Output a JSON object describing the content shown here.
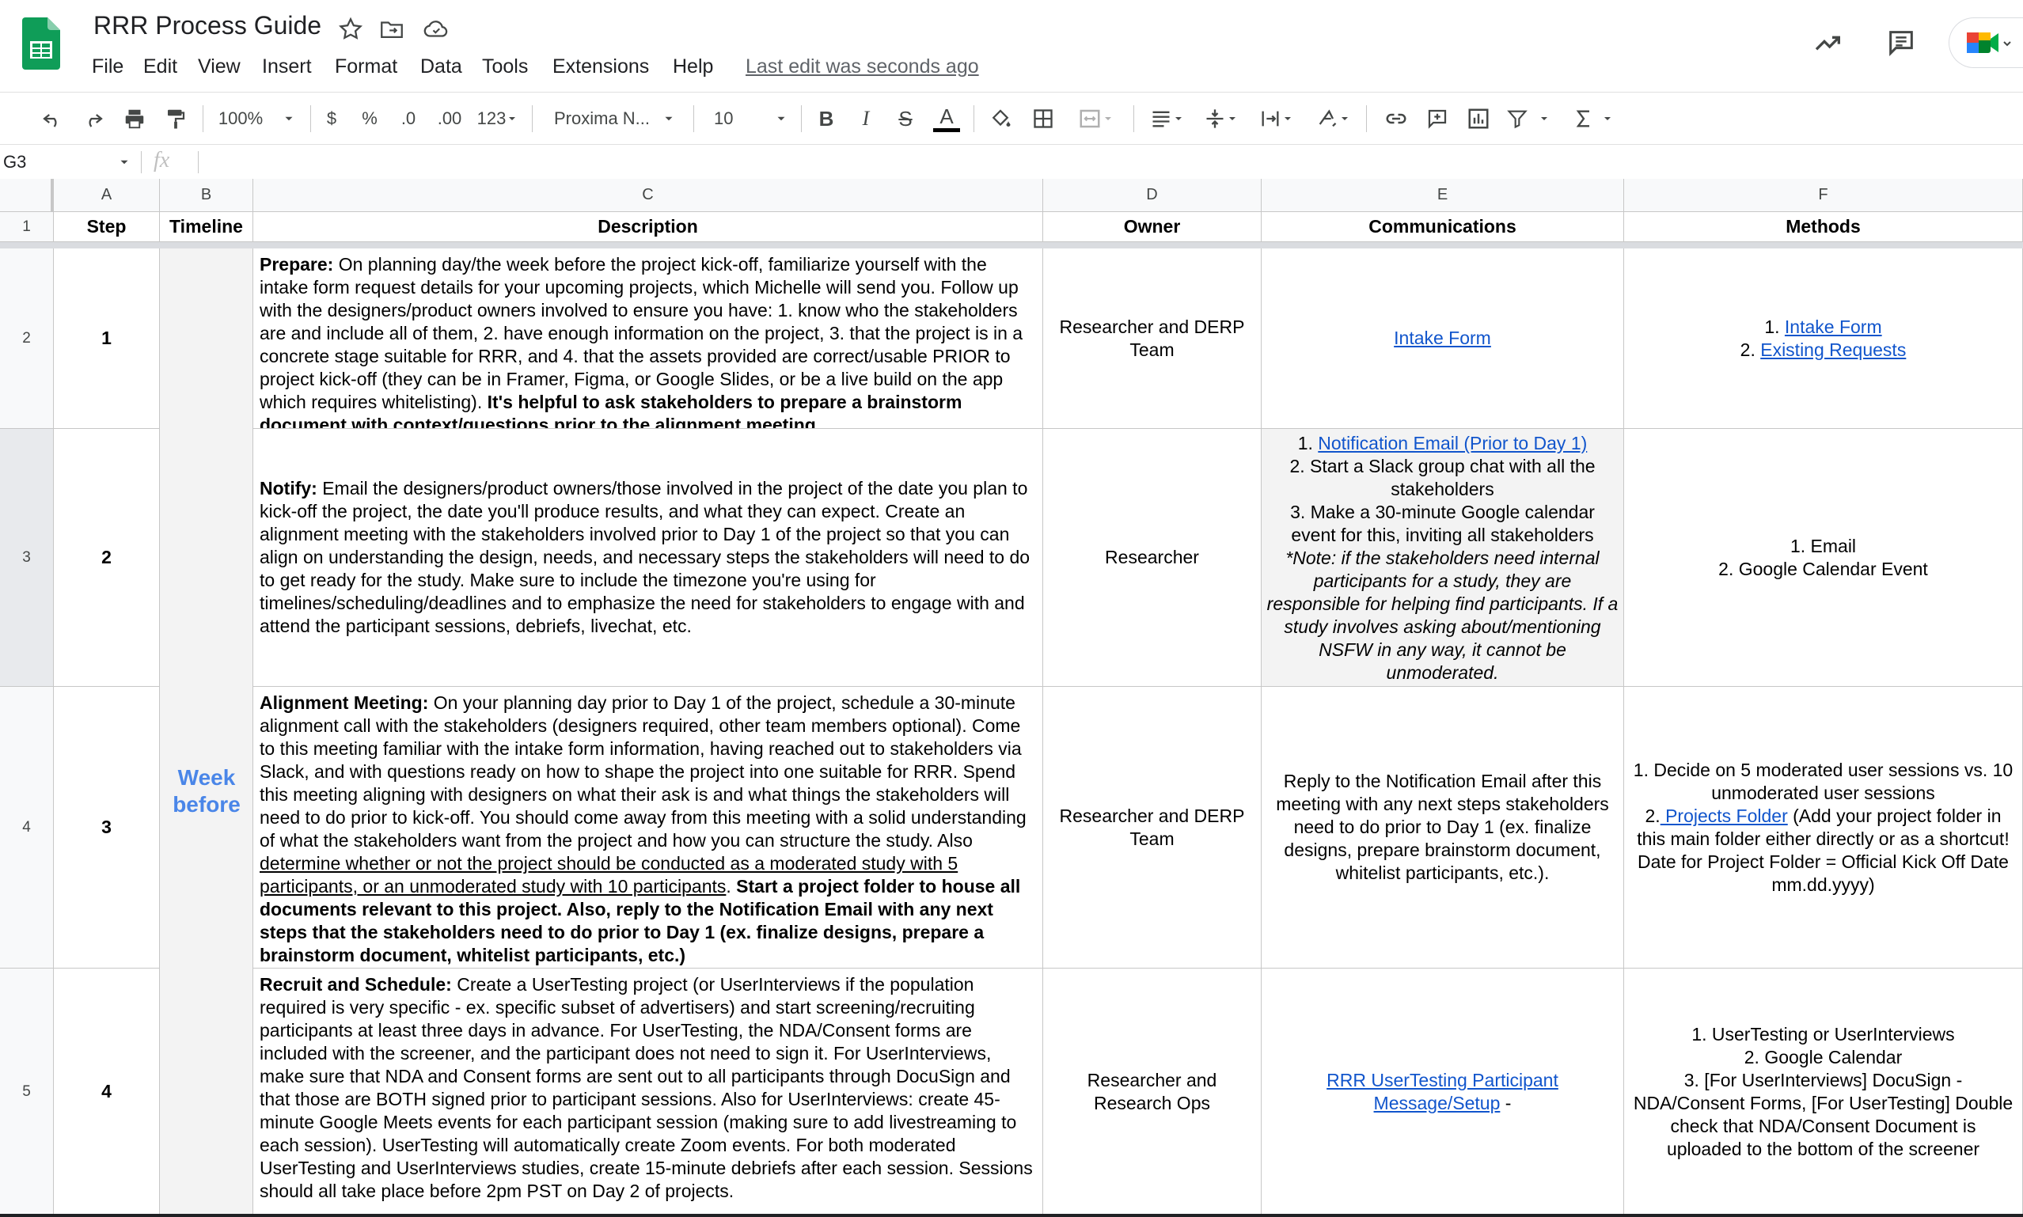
{
  "app": {
    "title": "RRR Process Guide",
    "menu": [
      "File",
      "Edit",
      "View",
      "Insert",
      "Format",
      "Data",
      "Tools",
      "Extensions",
      "Help"
    ],
    "last_edit": "Last edit was seconds ago"
  },
  "toolbar": {
    "zoom": "100%",
    "currency": "$",
    "percent": "%",
    "decrease_decimals": ".0",
    "increase_decimals": ".00",
    "more_formats": "123",
    "font": "Proxima N...",
    "font_size": "10",
    "bold": "B",
    "italic": "I",
    "strikethrough": "S",
    "text_color": "A"
  },
  "formula_bar": {
    "cell_ref": "G3",
    "fx": "fx",
    "value": ""
  },
  "columns": [
    "A",
    "B",
    "C",
    "D",
    "E",
    "F"
  ],
  "rows": [
    "1",
    "2",
    "3",
    "4",
    "5"
  ],
  "headers": {
    "step": "Step",
    "timeline": "Timeline",
    "description": "Description",
    "owner": "Owner",
    "communications": "Communications",
    "methods": "Methods"
  },
  "timeline_merged": "Week before",
  "r2": {
    "step": "1",
    "desc_bold1": "Prepare:",
    "desc_text1": " On planning day/the week before the project kick-off, familiarize yourself with the intake form request details for your upcoming projects, which Michelle will send you. Follow up with the designers/product owners involved to ensure you have: 1. know who the stakeholders are and include all of them, 2. have enough information on the project, 3. that the project is in a concrete stage suitable for RRR, and 4. that the assets provided are correct/usable PRIOR to project kick-off (they can be in Framer, Figma, or Google Slides, or be a live build on the app which requires whitelisting). ",
    "desc_bold2": "It's helpful to ask stakeholders to prepare a brainstorm document with context/questions prior to the alignment meeting.",
    "owner": "Researcher and DERP Team",
    "comm_link": "Intake Form",
    "methods_1_num": "1. ",
    "methods_1_link": "Intake Form",
    "methods_2_num": "2. ",
    "methods_2_link": "Existing Requests"
  },
  "r3": {
    "step": "2",
    "desc_bold1": "Notify:",
    "desc_text1": " Email the designers/product owners/those involved in the project of the date you plan to kick-off the project, the date you'll produce results, and what they can expect. Create an alignment meeting with the stakeholders involved prior to Day 1 of the project so that you can align on understanding the design, needs, and necessary steps the stakeholders will need to do to get ready for the study. Make sure to include the timezone you're using for timelines/scheduling/deadlines and to emphasize the need for stakeholders to engage with and attend the participant sessions, debriefs, livechat, etc.",
    "owner": "Researcher",
    "comm_1_num": "1. ",
    "comm_1_link": "Notification Email (Prior to Day 1)",
    "comm_2": "2. Start a Slack group chat with all the stakeholders",
    "comm_3": "3. Make a 30-minute Google calendar event for this, inviting all stakeholders",
    "comm_note": "*Note: if the stakeholders need internal participants for a study, they are responsible for helping find participants. If a study involves asking about/mentioning NSFW in any way, it cannot be unmoderated.",
    "methods_1": "1. Email",
    "methods_2": "2. Google Calendar Event"
  },
  "r4": {
    "step": "3",
    "desc_bold1": "Alignment Meeting:",
    "desc_text1": " On your planning day prior to Day 1 of the project, schedule a 30-minute alignment call with the stakeholders (designers required, other team members optional). Come to this meeting familiar with the intake form information, having reached out to stakeholders via Slack, and with questions ready on how to shape the project into one suitable for RRR. Spend this meeting aligning with designers on what their ask is and what things the stakeholders will need to do prior to kick-off. You should come away from this meeting with a solid understanding of what the stakeholders want from the project and how you can structure the study.  Also ",
    "desc_underline": "determine whether or not the project should be conducted as a moderated study with 5 participants, or an unmoderated study with 10 participants",
    "desc_text2": ". ",
    "desc_bold2": "Start a project folder to house all documents relevant to this project. Also, reply to the Notification Email with any next steps that the stakeholders need to do prior to Day 1 (ex. finalize designs, prepare a brainstorm document, whitelist participants, etc.)",
    "owner": "Researcher and DERP Team",
    "comm": "Reply to the Notification Email after this meeting with any next steps stakeholders need to do prior to Day 1 (ex. finalize designs, prepare brainstorm document, whitelist participants, etc.).",
    "methods_1": "1. Decide on 5 moderated user sessions vs. 10 unmoderated user sessions",
    "methods_2_num": "2.",
    "methods_2_link": " Projects Folder",
    "methods_2_text": " (Add your project folder in this main folder either directly or as a shortcut! Date for Project Folder = Official Kick Off Date mm.dd.yyyy)"
  },
  "r5": {
    "step": "4",
    "desc_bold1": "Recruit and Schedule:",
    "desc_text1": " Create a UserTesting project (or UserInterviews if the population required is very specific - ex. specific subset of advertisers) and start screening/recruiting participants at least three days in advance. For UserTesting, the NDA/Consent forms are included with the screener, and the participant does not need to sign it. For UserInterviews, make sure that NDA and Consent forms are sent out to all participants through DocuSign and that those are BOTH signed prior to participant sessions. Also for UserInterviews: create 45-minute Google Meets events for each participant session (making sure to add livestreaming to each session). UserTesting will automatically create Zoom events. For both moderated UserTesting and UserInterviews studies, create 15-minute debriefs after each session. Sessions should all take place before 2pm PST on Day 2 of projects.",
    "owner": "Researcher and Research Ops",
    "comm_link": "RRR UserTesting Participant Message/Setup",
    "comm_text": " -",
    "methods_1": "1. UserTesting or UserInterviews",
    "methods_2": "2. Google Calendar",
    "methods_3": "3. [For UserInterviews] DocuSign - NDA/Consent Forms, [For UserTesting] Double check that NDA/Consent Document is uploaded to the bottom of the screener"
  },
  "colors": {
    "sheets_green": "#0f9d58",
    "link": "#1155cc",
    "timeline_text": "#4a86e8",
    "header_bg": "#f8f9fa",
    "selected_cell_bg": "#f3f3f3"
  }
}
